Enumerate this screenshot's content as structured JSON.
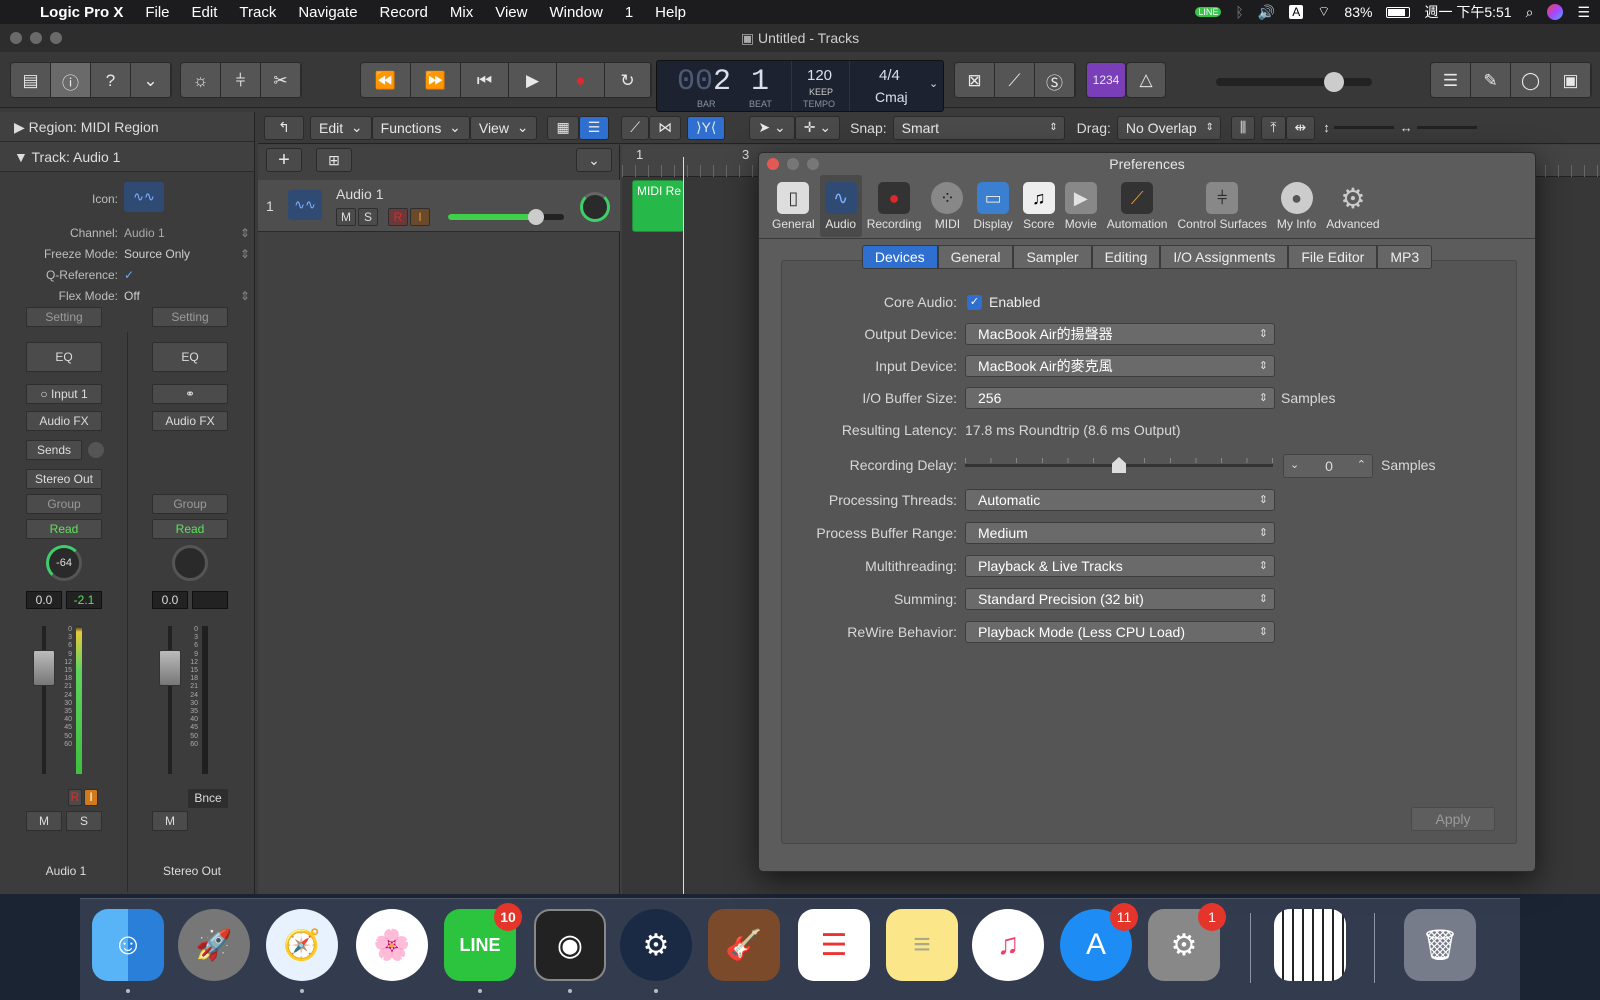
{
  "menubar": {
    "apple": "",
    "app": "Logic Pro X",
    "items": [
      "File",
      "Edit",
      "Track",
      "Navigate",
      "Record",
      "Mix",
      "View",
      "Window",
      "1",
      "Help"
    ],
    "battery": "83%",
    "clock": "週一 下午5:51",
    "input": "A"
  },
  "window": {
    "title": "Untitled - Tracks"
  },
  "lcd": {
    "bar_prefix": "00",
    "bar": "2",
    "beat": "1",
    "bar_label": "BAR",
    "beat_label": "BEAT",
    "tempo": "120",
    "keep": "KEEP",
    "tempo_label": "TEMPO",
    "signature": "4/4",
    "key": "Cmaj"
  },
  "count_in": "1234",
  "inspector": {
    "region": "Region: MIDI Region",
    "track": "Track: Audio 1",
    "icon_label": "Icon:",
    "channel_label": "Channel:",
    "channel": "Audio 1",
    "freeze_label": "Freeze Mode:",
    "freeze": "Source Only",
    "qref_label": "Q-Reference:",
    "qref": "✓",
    "flex_label": "Flex Mode:",
    "flex": "Off"
  },
  "strip1": {
    "setting": "Setting",
    "eq": "EQ",
    "input": "Input 1",
    "audiofx": "Audio FX",
    "sends": "Sends",
    "output": "Stereo Out",
    "group": "Group",
    "automation": "Read",
    "pan": "-64",
    "volume": "0.0",
    "peak": "-2.1",
    "r": "R",
    "i": "I",
    "m": "M",
    "s": "S",
    "name": "Audio 1"
  },
  "strip2": {
    "setting": "Setting",
    "eq": "EQ",
    "audiofx": "Audio FX",
    "group": "Group",
    "automation": "Read",
    "volume": "0.0",
    "bounce": "Bnce",
    "m": "M",
    "name": "Stereo Out"
  },
  "meter_scale": [
    "0",
    "3",
    "6",
    "9",
    "12",
    "15",
    "18",
    "21",
    "24",
    "30",
    "35",
    "40",
    "45",
    "50",
    "60"
  ],
  "tracktoolbar": {
    "edit": "Edit",
    "functions": "Functions",
    "view": "View",
    "snap_label": "Snap:",
    "snap": "Smart",
    "drag_label": "Drag:",
    "drag": "No Overlap"
  },
  "track": {
    "number": "1",
    "name": "Audio 1",
    "m": "M",
    "s": "S",
    "r": "R",
    "i": "I",
    "volume": 0.83
  },
  "ruler": {
    "m1": "1",
    "m3": "3"
  },
  "region": {
    "name": "MIDI Re"
  },
  "prefs": {
    "title": "Preferences",
    "toolbar": [
      "General",
      "Audio",
      "Recording",
      "MIDI",
      "Display",
      "Score",
      "Movie",
      "Automation",
      "Control Surfaces",
      "My Info",
      "Advanced"
    ],
    "tabs": [
      "Devices",
      "General",
      "Sampler",
      "Editing",
      "I/O Assignments",
      "File Editor",
      "MP3"
    ],
    "core_audio_label": "Core Audio:",
    "core_audio": "Enabled",
    "output_label": "Output Device:",
    "output": "MacBook Air的揚聲器",
    "input_label": "Input Device:",
    "input": "MacBook Air的麥克風",
    "buffer_label": "I/O Buffer Size:",
    "buffer": "256",
    "buffer_unit": "Samples",
    "latency_label": "Resulting Latency:",
    "latency": "17.8 ms Roundtrip (8.6 ms Output)",
    "delay_label": "Recording Delay:",
    "delay": "0",
    "delay_unit": "Samples",
    "threads_label": "Processing Threads:",
    "threads": "Automatic",
    "range_label": "Process Buffer Range:",
    "range": "Medium",
    "multi_label": "Multithreading:",
    "multi": "Playback & Live Tracks",
    "summing_label": "Summing:",
    "summing": "Standard Precision (32 bit)",
    "rewire_label": "ReWire Behavior:",
    "rewire": "Playback Mode (Less CPU Load)",
    "apply": "Apply"
  },
  "dock": {
    "items": [
      "Finder",
      "Launchpad",
      "Safari",
      "Photos",
      "LINE",
      "Logic Pro X",
      "Steam",
      "GarageBand",
      "Reminders",
      "Notes",
      "Music",
      "App Store",
      "System Preferences",
      "MIDI Keyboard",
      "Trash"
    ],
    "line_badge": "10",
    "appstore_badge": "11",
    "sysprefs_badge": "1"
  },
  "colors": {
    "accent": "#2f6fd0",
    "region": "#27b84a",
    "record": "#e0282a",
    "countin": "#7a3fb8"
  }
}
